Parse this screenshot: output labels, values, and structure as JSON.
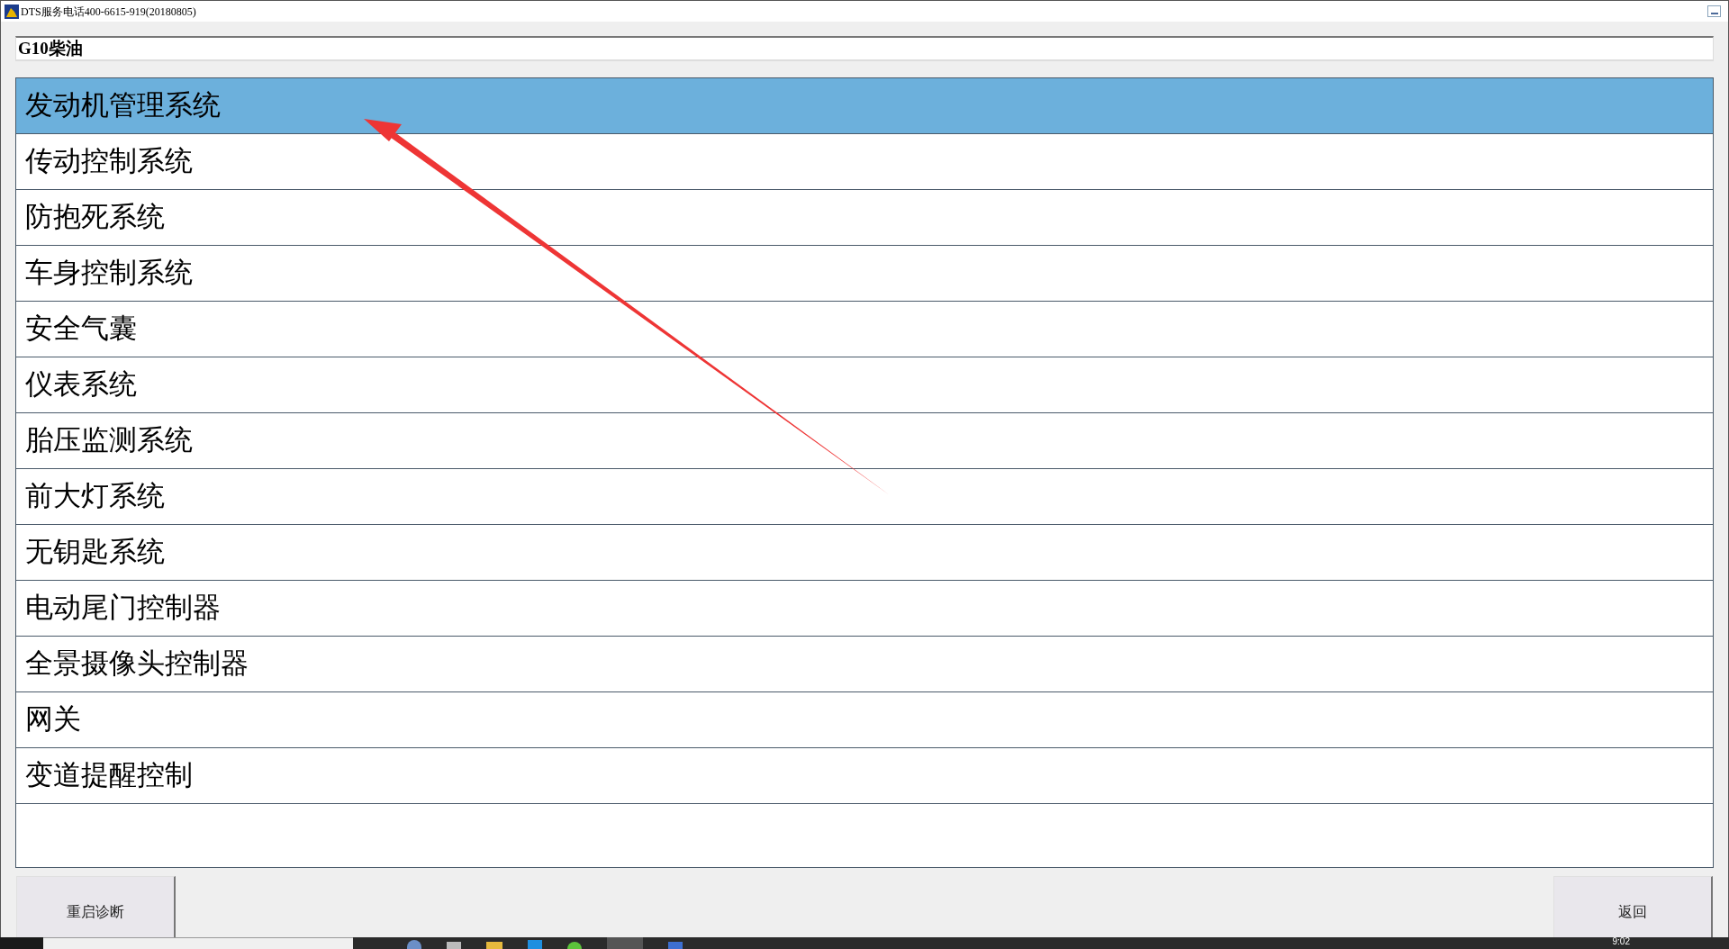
{
  "window": {
    "title": "DTS服务电话400-6615-919(20180805)"
  },
  "vehicle_field": {
    "value": "G10柴油"
  },
  "systems": [
    {
      "label": "发动机管理系统",
      "selected": true
    },
    {
      "label": "传动控制系统",
      "selected": false
    },
    {
      "label": "防抱死系统",
      "selected": false
    },
    {
      "label": "车身控制系统",
      "selected": false
    },
    {
      "label": "安全气囊",
      "selected": false
    },
    {
      "label": "仪表系统",
      "selected": false
    },
    {
      "label": "胎压监测系统",
      "selected": false
    },
    {
      "label": "前大灯系统",
      "selected": false
    },
    {
      "label": "无钥匙系统",
      "selected": false
    },
    {
      "label": "电动尾门控制器",
      "selected": false
    },
    {
      "label": "全景摄像头控制器",
      "selected": false
    },
    {
      "label": "网关",
      "selected": false
    },
    {
      "label": "变道提醒控制",
      "selected": false
    }
  ],
  "buttons": [
    "重启诊断",
    "返回"
  ],
  "taskbar": {
    "time": "9:02"
  }
}
